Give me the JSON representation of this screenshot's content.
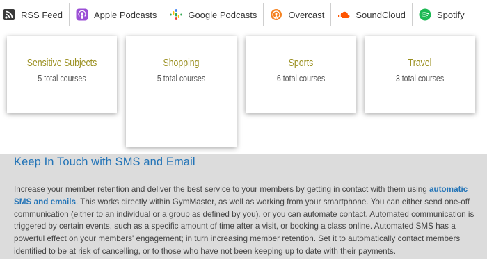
{
  "podcast_links": [
    {
      "label": "RSS Feed",
      "icon": "rss-icon"
    },
    {
      "label": "Apple Podcasts",
      "icon": "apple-podcasts-icon"
    },
    {
      "label": "Google Podcasts",
      "icon": "google-podcasts-icon"
    },
    {
      "label": "Overcast",
      "icon": "overcast-icon"
    },
    {
      "label": "SoundCloud",
      "icon": "soundcloud-icon"
    },
    {
      "label": "Spotify",
      "icon": "spotify-icon"
    }
  ],
  "courses": [
    {
      "title": "Sensitive Subjects",
      "count": "5 total courses"
    },
    {
      "title": "Shopping",
      "count": "5 total courses"
    },
    {
      "title": "Sports",
      "count": "6 total courses"
    },
    {
      "title": "Travel",
      "count": "3 total courses"
    }
  ],
  "section": {
    "heading": "Keep In Touch with SMS and Email",
    "para_before_link": "Increase your member retention and deliver the best service to your members by getting in contact with them using ",
    "link_text": "automatic SMS and emails",
    "para_after_link": ". This works directly within GymMaster, as well as working from your smartphone. You can either send one-off communication (either to an individual or a group as defined by you), or you can automate contact. Automated communication is triggered by certain events, such as a specific amount of time after a visit, or booking a class online. Automated SMS has a powerful effect on your members' engagement; in turn increasing member retention. Set it to automatically contact members identified to be at risk of cancelling, or to those who have not been keeping up to date with their payments."
  },
  "colors": {
    "course_title": "#9a8f1f",
    "heading": "#2374b7",
    "section_bg": "#dcdcdc",
    "apple_podcasts": "#9b4fd6",
    "overcast": "#f58220",
    "soundcloud": "#ff5500",
    "spotify": "#1db954"
  }
}
